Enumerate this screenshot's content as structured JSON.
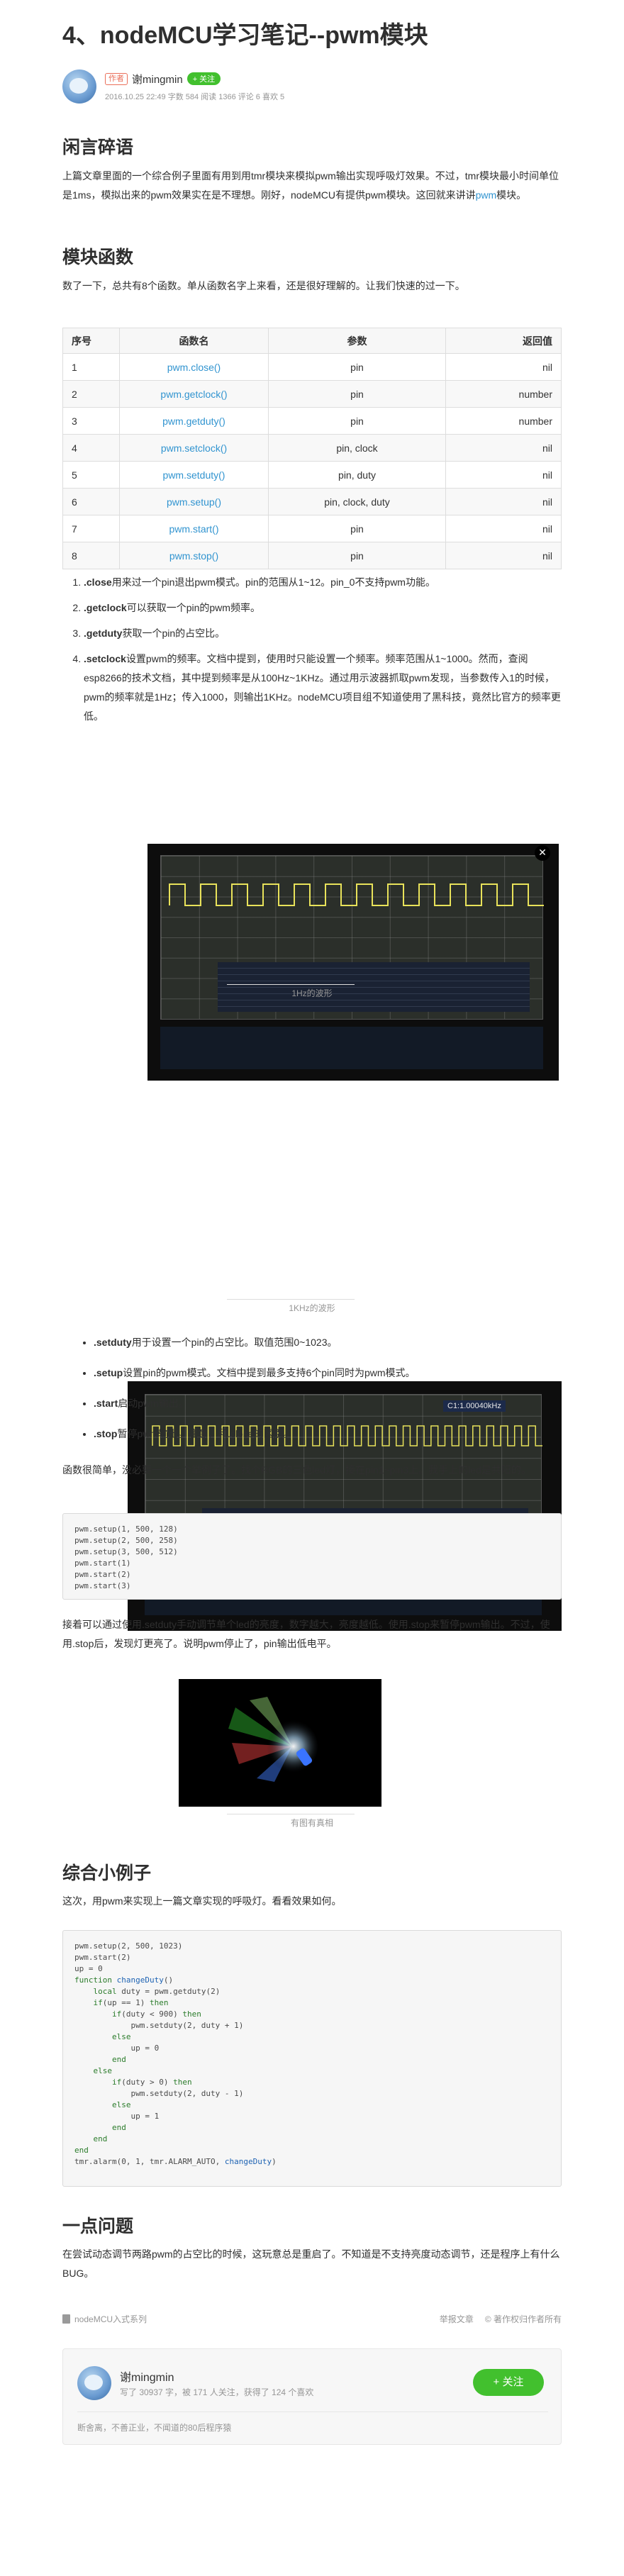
{
  "article": {
    "title": "4、nodeMCU学习笔记--pwm模块",
    "author_badge": "作者",
    "author": "谢mingmin",
    "follow": "+ 关注",
    "meta": "2016.10.25 22:49  字数 584  阅读 1366 评论 6 喜欢 5"
  },
  "sections": {
    "intro_title": "闲言碎语",
    "intro_text_1": "上篇文章里面的一个综合例子里面有用到用tmr模块来模拟pwm输出实现呼吸灯效果。不过，tmr模块最小时间单位是1ms，模拟出来的pwm效果实在是不理想。刚好，nodeMCU有提供pwm模块。这回就来讲讲",
    "intro_link": "pwm",
    "intro_text_2": "模块。",
    "functions_title": "模块函数",
    "functions_text": "数了一下，总共有8个函数。单从函数名字上来看，还是很好理解的。让我们快速的过一下。",
    "demo_title": "综合小例子",
    "demo_text": "这次，用pwm来实现上一篇文章实现的呼吸灯。看看效果如何。",
    "issue_title": "一点问题",
    "issue_text": "在尝试动态调节两路pwm的占空比的时候，这玩意总是重启了。不知道是不支持亮度动态调节，还是程序上有什么BUG。"
  },
  "table": {
    "headers": [
      "序号",
      "函数名",
      "参数",
      "返回值"
    ],
    "rows": [
      [
        "1",
        "pwm.close()",
        "pin",
        "nil"
      ],
      [
        "2",
        "pwm.getclock()",
        "pin",
        "number"
      ],
      [
        "3",
        "pwm.getduty()",
        "pin",
        "number"
      ],
      [
        "4",
        "pwm.setclock()",
        "pin, clock",
        "nil"
      ],
      [
        "5",
        "pwm.setduty()",
        "pin, duty",
        "nil"
      ],
      [
        "6",
        "pwm.setup()",
        "pin, clock, duty",
        "nil"
      ],
      [
        "7",
        "pwm.start()",
        "pin",
        "nil"
      ],
      [
        "8",
        "pwm.stop()",
        "pin",
        "nil"
      ]
    ]
  },
  "list1": [
    {
      "key": ".close",
      "text": "用来过一个pin退出pwm模式。pin的范围从1~12。pin_0不支持pwm功能。"
    },
    {
      "key": ".getclock",
      "text": "可以获取一个pin的pwm频率。"
    },
    {
      "key": ".getduty",
      "text": "获取一个pin的占空比。"
    },
    {
      "key": ".setclock",
      "text": "设置pwm的频率。文档中提到，使用时只能设置一个频率。频率范围从1~1000。然而，查阅esp8266的技术文档，其中提到频率是从100Hz~1KHz。通过用示波器抓取pwm发现，当参数传入1的时候，pwm的频率就是1Hz；传入1000，则输出1KHz。nodeMCU项目组不知道使用了黑科技，竟然比官方的频率更低。"
    }
  ],
  "figures": {
    "scope1_caption": "1Hz的波形",
    "scope2_caption": "1KHz的波形",
    "scope2_readout": "C1:1.00040kHz",
    "led_caption": "有图有真相"
  },
  "list2": [
    {
      "key": ".setduty",
      "text": "用于设置一个pin的占空比。取值范围0~1023。"
    },
    {
      "key": ".setup",
      "text": "设置pin的pwm模式。文档中提到最多支持6个pin同时为pwm模式。"
    },
    {
      "key": ".start",
      "text": "启动pwm输出。"
    },
    {
      "key": ".stop",
      "text": "暂停pwm输出。注意，和.close的区别。"
    }
  ],
  "example": {
    "text": "函数很简单，没必要一个一个举例子了。找个RGB的三色led灯，接在pin1~pin3上。我手上的led是共阳的。",
    "code": [
      "pwm.setup(1, 500, 128)",
      "pwm.setup(2, 500, 258)",
      "pwm.setup(3, 500, 512)",
      "pwm.start(1)",
      "pwm.start(2)",
      "pwm.start(3)"
    ],
    "after_text": "接着可以通过使用.setduty手动调节单个led的亮度，数字越大，亮度越低。使用.stop来暂停pwm输出。不过，使用.stop后，发现灯更亮了。说明pwm停止了，pin输出低电平。"
  },
  "demo_code": [
    "pwm.setup(2, 500, 1023)",
    "pwm.start(2)",
    "up = 0",
    "function changeDuty()",
    "    local duty = pwm.getduty(2)",
    "    if(up == 1) then",
    "        if(duty < 900) then",
    "            pwm.setduty(2, duty + 1)",
    "        else",
    "            up = 0",
    "        end",
    "    else",
    "        if(duty > 0) then",
    "            pwm.setduty(2, duty - 1)",
    "        else",
    "            up = 1",
    "        end",
    "    end",
    "end",
    "tmr.alarm(0, 1, tmr.ALARM_AUTO, changeDuty)"
  ],
  "footer": {
    "collection": "nodeMCU入式系列",
    "report": "举报文章",
    "copyright": "© 著作权归作者所有"
  },
  "author_card": {
    "name": "谢mingmin",
    "stats": "写了 30937 字，被 171 人关注，获得了 124 个喜欢",
    "bio": "断舍离，不善正业，不闻道的80后程序猿",
    "follow": "+ 关注"
  },
  "colors": {
    "link": "#3194d0",
    "follow_green": "#42c02e",
    "badge_red": "#ea6f5a",
    "waveform": "#e8e25a"
  }
}
